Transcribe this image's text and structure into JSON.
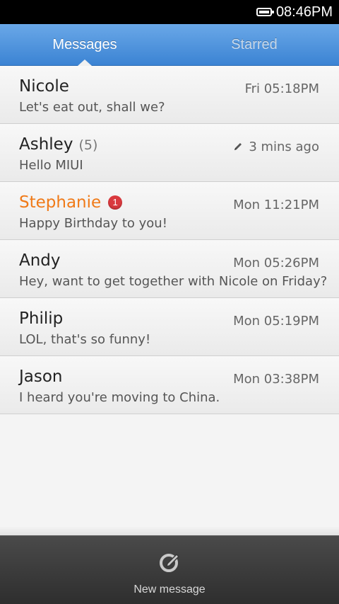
{
  "status_bar": {
    "time": "08:46PM",
    "battery_icon": "battery-full-icon"
  },
  "tabs": [
    {
      "label": "Messages",
      "active": true
    },
    {
      "label": "Starred",
      "active": false
    }
  ],
  "conversations": [
    {
      "name": "Nicole",
      "time": "Fri 05:18PM",
      "preview": "Let's eat out, shall we?"
    },
    {
      "name": "Ashley",
      "count": "(5)",
      "time": "3 mins ago",
      "preview": "Hello MIUI",
      "draft_icon": "pencil-icon"
    },
    {
      "name": "Stephanie",
      "badge": "1",
      "time": "Mon 11:21PM",
      "preview": "Happy Birthday to you!",
      "unread": true,
      "name_color": "#f07a18"
    },
    {
      "name": "Andy",
      "time": "Mon 05:26PM",
      "preview": "Hey, want to get together with Nicole on Friday?"
    },
    {
      "name": "Philip",
      "time": "Mon 05:19PM",
      "preview": "LOL, that's so funny!"
    },
    {
      "name": "Jason",
      "time": "Mon 03:38PM",
      "preview": "I heard you're moving to China."
    }
  ],
  "bottom_bar": {
    "new_message_label": "New message",
    "icon": "compose-icon"
  },
  "colors": {
    "tab_bar": "#3b83d3",
    "unread_name": "#f07a18",
    "badge": "#d9393e"
  }
}
